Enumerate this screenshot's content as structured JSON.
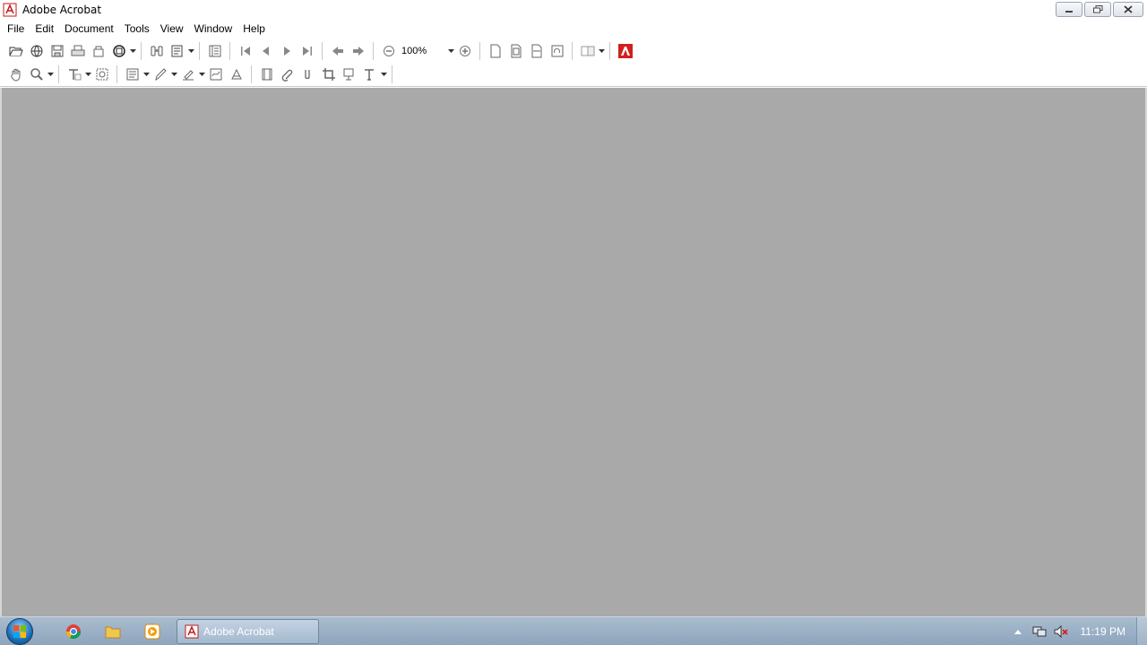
{
  "window": {
    "title": "Adobe Acrobat"
  },
  "menu": [
    "File",
    "Edit",
    "Document",
    "Tools",
    "View",
    "Window",
    "Help"
  ],
  "toolbar": {
    "zoom_value": "100%"
  },
  "taskbar": {
    "active_app": "Adobe Acrobat",
    "clock": "11:19 PM"
  },
  "colors": {
    "document_bg": "#a9a9a9",
    "acrobat_red": "#d21f1f",
    "taskbar": "#9eb2c6"
  }
}
